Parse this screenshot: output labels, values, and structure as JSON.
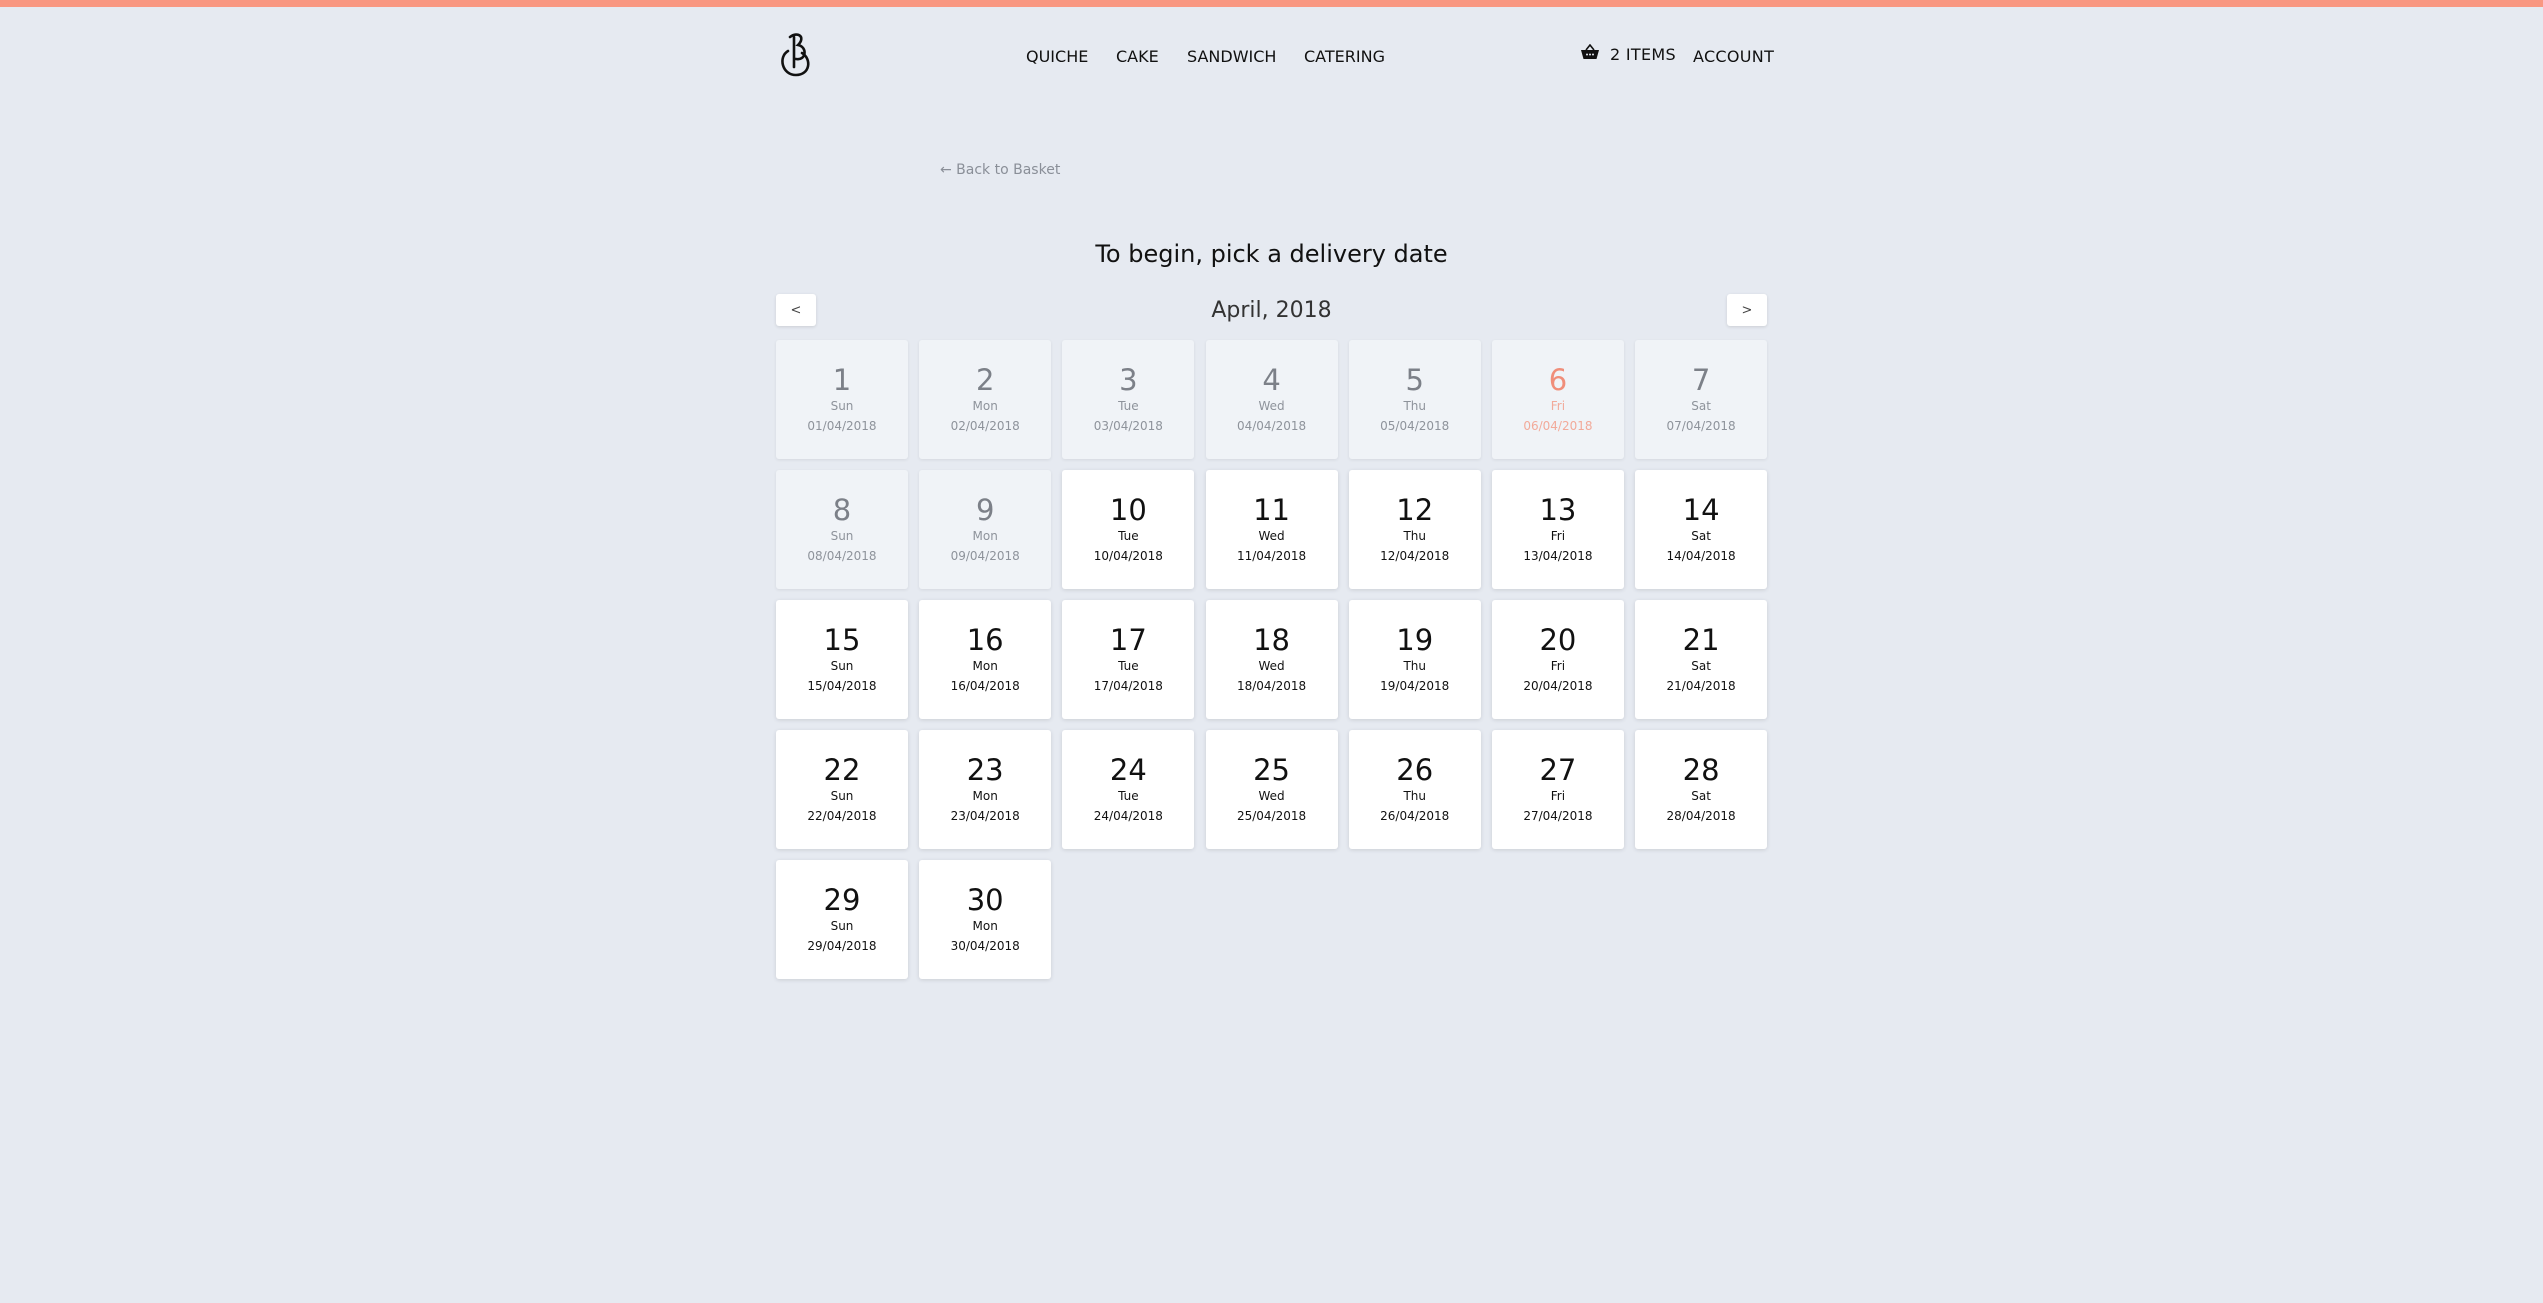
{
  "colors": {
    "accent_bar": "#f99781",
    "background": "#e6eaf1",
    "holiday_text": "#f08e7a"
  },
  "header": {
    "logo_icon": "b-logo-icon",
    "nav": [
      {
        "label": "QUICHE"
      },
      {
        "label": "CAKE"
      },
      {
        "label": "SANDWICH"
      },
      {
        "label": "CATERING"
      }
    ],
    "basket": {
      "icon": "basket-icon",
      "label": "2 ITEMS"
    },
    "account_label": "ACCOUNT"
  },
  "back_link": "← Back to Basket",
  "title": "To begin, pick a delivery date",
  "calendar": {
    "month_label": "April, 2018",
    "prev_label": "<",
    "next_label": ">",
    "days": [
      {
        "num": "1",
        "dow": "Sun",
        "date": "01/04/2018",
        "state": "disabled"
      },
      {
        "num": "2",
        "dow": "Mon",
        "date": "02/04/2018",
        "state": "disabled"
      },
      {
        "num": "3",
        "dow": "Tue",
        "date": "03/04/2018",
        "state": "disabled"
      },
      {
        "num": "4",
        "dow": "Wed",
        "date": "04/04/2018",
        "state": "disabled"
      },
      {
        "num": "5",
        "dow": "Thu",
        "date": "05/04/2018",
        "state": "disabled"
      },
      {
        "num": "6",
        "dow": "Fri",
        "date": "06/04/2018",
        "state": "holiday"
      },
      {
        "num": "7",
        "dow": "Sat",
        "date": "07/04/2018",
        "state": "disabled"
      },
      {
        "num": "8",
        "dow": "Sun",
        "date": "08/04/2018",
        "state": "disabled"
      },
      {
        "num": "9",
        "dow": "Mon",
        "date": "09/04/2018",
        "state": "disabled"
      },
      {
        "num": "10",
        "dow": "Tue",
        "date": "10/04/2018",
        "state": "available"
      },
      {
        "num": "11",
        "dow": "Wed",
        "date": "11/04/2018",
        "state": "available"
      },
      {
        "num": "12",
        "dow": "Thu",
        "date": "12/04/2018",
        "state": "available"
      },
      {
        "num": "13",
        "dow": "Fri",
        "date": "13/04/2018",
        "state": "available"
      },
      {
        "num": "14",
        "dow": "Sat",
        "date": "14/04/2018",
        "state": "available"
      },
      {
        "num": "15",
        "dow": "Sun",
        "date": "15/04/2018",
        "state": "available"
      },
      {
        "num": "16",
        "dow": "Mon",
        "date": "16/04/2018",
        "state": "available"
      },
      {
        "num": "17",
        "dow": "Tue",
        "date": "17/04/2018",
        "state": "available"
      },
      {
        "num": "18",
        "dow": "Wed",
        "date": "18/04/2018",
        "state": "available"
      },
      {
        "num": "19",
        "dow": "Thu",
        "date": "19/04/2018",
        "state": "available"
      },
      {
        "num": "20",
        "dow": "Fri",
        "date": "20/04/2018",
        "state": "available"
      },
      {
        "num": "21",
        "dow": "Sat",
        "date": "21/04/2018",
        "state": "available"
      },
      {
        "num": "22",
        "dow": "Sun",
        "date": "22/04/2018",
        "state": "available"
      },
      {
        "num": "23",
        "dow": "Mon",
        "date": "23/04/2018",
        "state": "available"
      },
      {
        "num": "24",
        "dow": "Tue",
        "date": "24/04/2018",
        "state": "available"
      },
      {
        "num": "25",
        "dow": "Wed",
        "date": "25/04/2018",
        "state": "available"
      },
      {
        "num": "26",
        "dow": "Thu",
        "date": "26/04/2018",
        "state": "available"
      },
      {
        "num": "27",
        "dow": "Fri",
        "date": "27/04/2018",
        "state": "available"
      },
      {
        "num": "28",
        "dow": "Sat",
        "date": "28/04/2018",
        "state": "available"
      },
      {
        "num": "29",
        "dow": "Sun",
        "date": "29/04/2018",
        "state": "available"
      },
      {
        "num": "30",
        "dow": "Mon",
        "date": "30/04/2018",
        "state": "available"
      }
    ]
  }
}
